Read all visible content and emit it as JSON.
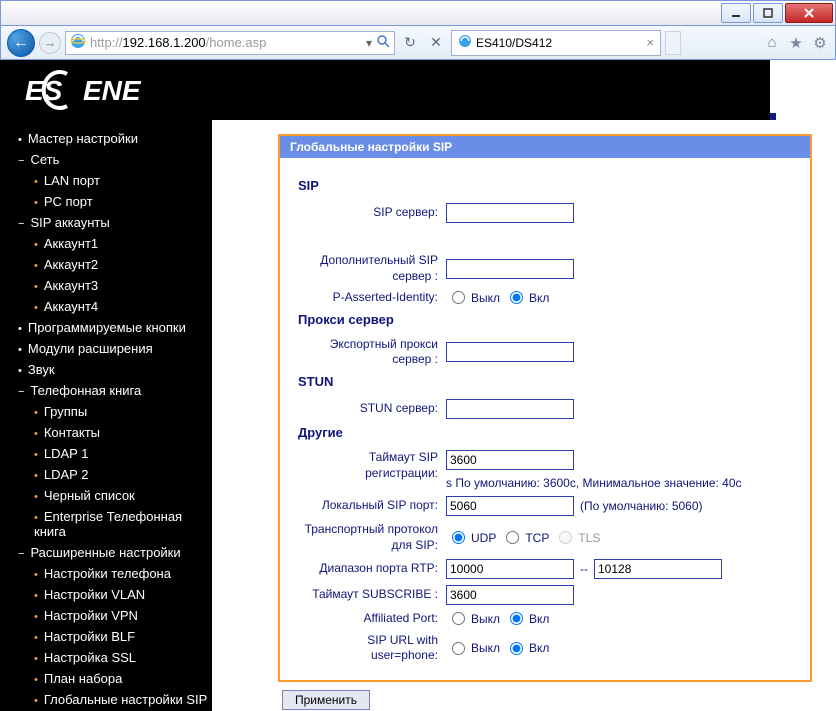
{
  "window": {
    "url_prefix": "http://",
    "url_domain": "192.168.1.200",
    "url_path": "/home.asp",
    "tab_title": "ES410/DS412"
  },
  "logo_text": "ESCENE",
  "nav": {
    "master": "Мастер настройки",
    "network": "Сеть",
    "lan": "LAN порт",
    "pc": "PC порт",
    "sip_acc": "SIP аккаунты",
    "acc1": "Аккаунт1",
    "acc2": "Аккаунт2",
    "acc3": "Аккаунт3",
    "acc4": "Аккаунт4",
    "prog_keys": "Программируемые кнопки",
    "exp_modules": "Модули расширения",
    "sound": "Звук",
    "phonebook": "Телефонная книга",
    "groups": "Группы",
    "contacts": "Контакты",
    "ldap1": "LDAP 1",
    "ldap2": "LDAP 2",
    "blacklist": "Черный список",
    "ent_pb": "Enterprise Телефонная книга",
    "adv": "Расширенные настройки",
    "phone_set": "Настройки телефона",
    "vlan": "Настройки VLAN",
    "vpn": "Настройки VPN",
    "blf": "Настройки BLF",
    "ssl": "Настройка SSL",
    "dialplan": "План набора",
    "global_sip_nav": "Глобальные настройки SIP"
  },
  "panel": {
    "header": "Глобальные настройки SIP",
    "sip_h": "SIP",
    "sip_server_lbl": "SIP сервер:",
    "sip_server_val": "",
    "sec_sip_lbl": "Дополнительный SIP сервер :",
    "sec_sip_val": "",
    "pai_lbl": "P-Asserted-Identity:",
    "off": "Выкл",
    "on": "Вкл",
    "proxy_h": "Прокси сервер",
    "export_proxy_lbl": "Экспортный прокси сервер :",
    "export_proxy_val": "",
    "stun_h": "STUN",
    "stun_lbl": "STUN сервер:",
    "stun_val": "",
    "other_h": "Другие",
    "reg_timeout_lbl": "Таймаут SIP регистрации:",
    "reg_timeout_val": "3600",
    "reg_timeout_hint": "s По умолчанию: 3600с, Минимальное значение: 40с",
    "local_port_lbl": "Локальный SIP порт:",
    "local_port_val": "5060",
    "local_port_hint": "(По умолчанию: 5060)",
    "transport_lbl": "Транспортный протокол для SIP:",
    "udp": "UDP",
    "tcp": "TCP",
    "tls": "TLS",
    "rtp_range_lbl": "Диапазон порта RTP:",
    "rtp_from": "10000",
    "rtp_sep": "--",
    "rtp_to": "10128",
    "sub_timeout_lbl": "Таймаут SUBSCRIBE :",
    "sub_timeout_val": "3600",
    "aff_port_lbl": "Affiliated Port:",
    "sip_url_lbl": "SIP URL with user=phone:",
    "apply": "Применить"
  }
}
